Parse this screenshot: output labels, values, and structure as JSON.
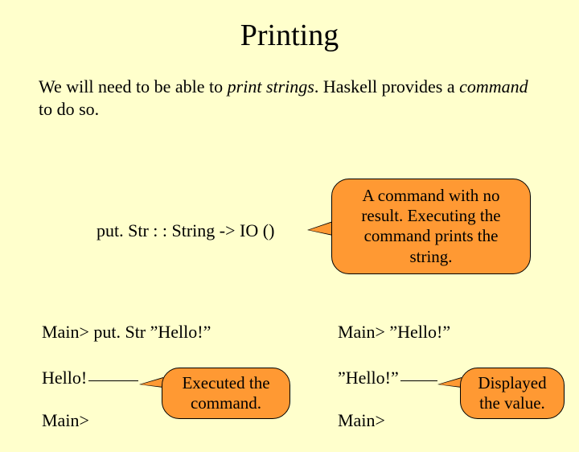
{
  "title": "Printing",
  "intro": {
    "part1": "We will need to be able to ",
    "emph1": "print strings",
    "part2": ". Haskell provides a ",
    "emph2": "command",
    "part3": " to do so."
  },
  "type_sig": "put. Str : : String -> IO ()",
  "callout_big": "A command with no result. Executing the command prints the string.",
  "callout_exec": "Executed the command.",
  "callout_disp": "Displayed the value.",
  "left": {
    "line1": "Main> put. Str ”Hello!”",
    "line2": "Hello!",
    "line3": "Main>"
  },
  "right": {
    "line1": "Main> ”Hello!”",
    "line2": "”Hello!”",
    "line3": "Main>"
  }
}
